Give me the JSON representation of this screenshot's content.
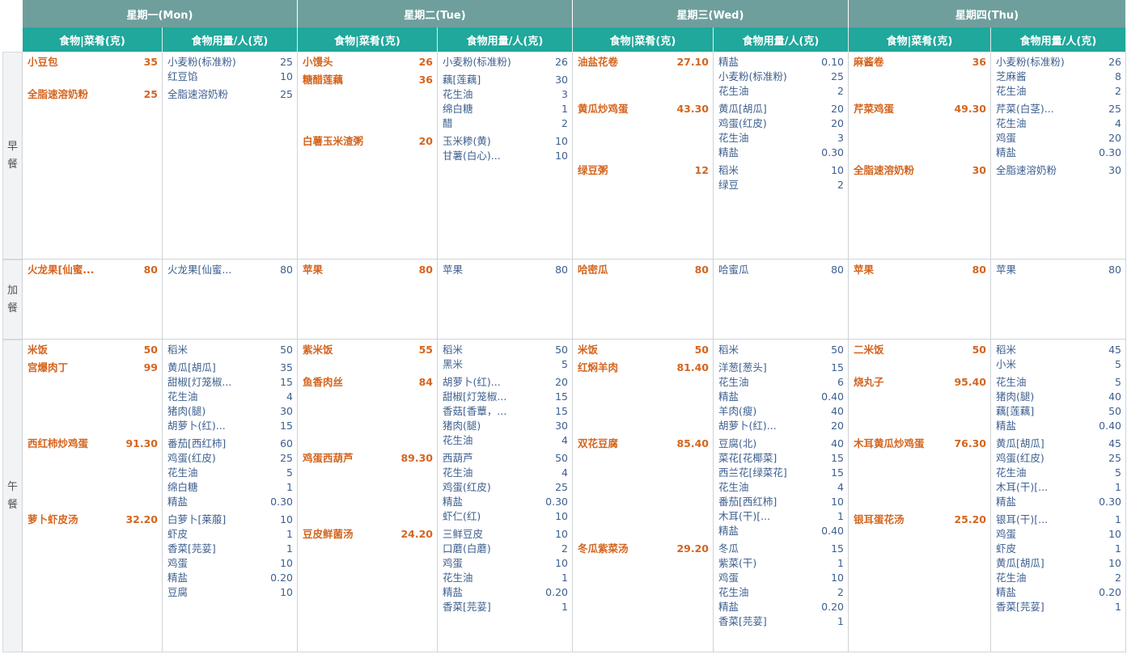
{
  "days": [
    {
      "label": "星期一(Mon)",
      "dish_header": "食物|菜肴(克)",
      "ing_header": "食物用量/人(克)"
    },
    {
      "label": "星期二(Tue)",
      "dish_header": "食物|菜肴(克)",
      "ing_header": "食物用量/人(克)"
    },
    {
      "label": "星期三(Wed)",
      "dish_header": "食物|菜肴(克)",
      "ing_header": "食物用量/人(克)"
    },
    {
      "label": "星期四(Thu)",
      "dish_header": "食物|菜肴(克)",
      "ing_header": "食物用量/人(克)"
    }
  ],
  "meals": [
    {
      "chars": [
        "早",
        "餐"
      ]
    },
    {
      "chars": [
        "加",
        "餐"
      ]
    },
    {
      "chars": [
        "午",
        "餐"
      ]
    }
  ],
  "menu": [
    [
      [
        {
          "name": "小豆包",
          "weight": "35",
          "ingredients": [
            [
              "小麦粉(标准粉)",
              "25"
            ],
            [
              "红豆馅",
              "10"
            ]
          ]
        },
        {
          "name": "全脂速溶奶粉",
          "weight": "25",
          "ingredients": [
            [
              "全脂速溶奶粉",
              "25"
            ]
          ]
        }
      ],
      [
        {
          "name": "火龙果[仙蜜...",
          "weight": "80",
          "ingredients": [
            [
              "火龙果[仙蜜...",
              "80"
            ]
          ]
        }
      ],
      [
        {
          "name": "米饭",
          "weight": "50",
          "ingredients": [
            [
              "稻米",
              "50"
            ]
          ]
        },
        {
          "name": "宫爆肉丁",
          "weight": "99",
          "ingredients": [
            [
              "黄瓜[胡瓜]",
              "35"
            ],
            [
              "甜椒[灯笼椒...",
              "15"
            ],
            [
              "花生油",
              "4"
            ],
            [
              "猪肉(腿)",
              "30"
            ],
            [
              "胡萝卜(红)...",
              "15"
            ]
          ]
        },
        {
          "name": "西红柿炒鸡蛋",
          "weight": "91.30",
          "ingredients": [
            [
              "番茄[西红柿]",
              "60"
            ],
            [
              "鸡蛋(红皮)",
              "25"
            ],
            [
              "花生油",
              "5"
            ],
            [
              "绵白糖",
              "1"
            ],
            [
              "精盐",
              "0.30"
            ]
          ]
        },
        {
          "name": "萝卜虾皮汤",
          "weight": "32.20",
          "ingredients": [
            [
              "白萝卜[莱菔]",
              "10"
            ],
            [
              "虾皮",
              "1"
            ],
            [
              "香菜[芫荽]",
              "1"
            ],
            [
              "鸡蛋",
              "10"
            ],
            [
              "精盐",
              "0.20"
            ],
            [
              "豆腐",
              "10"
            ]
          ]
        }
      ]
    ],
    [
      [
        {
          "name": "小馒头",
          "weight": "26",
          "ingredients": [
            [
              "小麦粉(标准粉)",
              "26"
            ]
          ]
        },
        {
          "name": "糖醋莲藕",
          "weight": "36",
          "ingredients": [
            [
              "藕[莲藕]",
              "30"
            ],
            [
              "花生油",
              "3"
            ],
            [
              "绵白糖",
              "1"
            ],
            [
              "醋",
              "2"
            ]
          ]
        },
        {
          "name": "白薯玉米渣粥",
          "weight": "20",
          "ingredients": [
            [
              "玉米糁(黄)",
              "10"
            ],
            [
              "甘薯(白心)...",
              "10"
            ]
          ]
        }
      ],
      [
        {
          "name": "苹果",
          "weight": "80",
          "ingredients": [
            [
              "苹果",
              "80"
            ]
          ]
        }
      ],
      [
        {
          "name": "紫米饭",
          "weight": "55",
          "ingredients": [
            [
              "稻米",
              "50"
            ],
            [
              "黑米",
              "5"
            ]
          ]
        },
        {
          "name": "鱼香肉丝",
          "weight": "84",
          "ingredients": [
            [
              "胡萝卜(红)...",
              "20"
            ],
            [
              "甜椒[灯笼椒...",
              "15"
            ],
            [
              "香菇[香蕈，...",
              "15"
            ],
            [
              "猪肉(腿)",
              "30"
            ],
            [
              "花生油",
              "4"
            ]
          ]
        },
        {
          "name": "鸡蛋西葫芦",
          "weight": "89.30",
          "ingredients": [
            [
              "西葫芦",
              "50"
            ],
            [
              "花生油",
              "4"
            ],
            [
              "鸡蛋(红皮)",
              "25"
            ],
            [
              "精盐",
              "0.30"
            ],
            [
              "虾仁(红)",
              "10"
            ]
          ]
        },
        {
          "name": "豆皮鲜菌汤",
          "weight": "24.20",
          "ingredients": [
            [
              "三鲜豆皮",
              "10"
            ],
            [
              "口蘑(白蘑)",
              "2"
            ],
            [
              "鸡蛋",
              "10"
            ],
            [
              "花生油",
              "1"
            ],
            [
              "精盐",
              "0.20"
            ],
            [
              "香菜[芫荽]",
              "1"
            ]
          ]
        }
      ]
    ],
    [
      [
        {
          "name": "油盐花卷",
          "weight": "27.10",
          "ingredients": [
            [
              "精盐",
              "0.10"
            ],
            [
              "小麦粉(标准粉)",
              "25"
            ],
            [
              "花生油",
              "2"
            ]
          ]
        },
        {
          "name": "黄瓜炒鸡蛋",
          "weight": "43.30",
          "ingredients": [
            [
              "黄瓜[胡瓜]",
              "20"
            ],
            [
              "鸡蛋(红皮)",
              "20"
            ],
            [
              "花生油",
              "3"
            ],
            [
              "精盐",
              "0.30"
            ]
          ]
        },
        {
          "name": "绿豆粥",
          "weight": "12",
          "ingredients": [
            [
              "稻米",
              "10"
            ],
            [
              "绿豆",
              "2"
            ]
          ]
        }
      ],
      [
        {
          "name": "哈密瓜",
          "weight": "80",
          "ingredients": [
            [
              "哈蜜瓜",
              "80"
            ]
          ]
        }
      ],
      [
        {
          "name": "米饭",
          "weight": "50",
          "ingredients": [
            [
              "稻米",
              "50"
            ]
          ]
        },
        {
          "name": "红焖羊肉",
          "weight": "81.40",
          "ingredients": [
            [
              "洋葱[葱头]",
              "15"
            ],
            [
              "花生油",
              "6"
            ],
            [
              "精盐",
              "0.40"
            ],
            [
              "羊肉(瘦)",
              "40"
            ],
            [
              "胡萝卜(红)...",
              "20"
            ]
          ]
        },
        {
          "name": "双花豆腐",
          "weight": "85.40",
          "ingredients": [
            [
              "豆腐(北)",
              "40"
            ],
            [
              "菜花[花椰菜]",
              "15"
            ],
            [
              "西兰花[绿菜花]",
              "15"
            ],
            [
              "花生油",
              "4"
            ],
            [
              "番茄[西红柿]",
              "10"
            ],
            [
              "木耳(干)[...",
              "1"
            ],
            [
              "精盐",
              "0.40"
            ]
          ]
        },
        {
          "name": "冬瓜紫菜汤",
          "weight": "29.20",
          "ingredients": [
            [
              "冬瓜",
              "15"
            ],
            [
              "紫菜(干)",
              "1"
            ],
            [
              "鸡蛋",
              "10"
            ],
            [
              "花生油",
              "2"
            ],
            [
              "精盐",
              "0.20"
            ],
            [
              "香菜[芫荽]",
              "1"
            ]
          ]
        }
      ]
    ],
    [
      [
        {
          "name": "麻酱卷",
          "weight": "36",
          "ingredients": [
            [
              "小麦粉(标准粉)",
              "26"
            ],
            [
              "芝麻酱",
              "8"
            ],
            [
              "花生油",
              "2"
            ]
          ]
        },
        {
          "name": "芹菜鸡蛋",
          "weight": "49.30",
          "ingredients": [
            [
              "芹菜(白茎)...",
              "25"
            ],
            [
              "花生油",
              "4"
            ],
            [
              "鸡蛋",
              "20"
            ],
            [
              "精盐",
              "0.30"
            ]
          ]
        },
        {
          "name": "全脂速溶奶粉",
          "weight": "30",
          "ingredients": [
            [
              "全脂速溶奶粉",
              "30"
            ]
          ]
        }
      ],
      [
        {
          "name": "苹果",
          "weight": "80",
          "ingredients": [
            [
              "苹果",
              "80"
            ]
          ]
        }
      ],
      [
        {
          "name": "二米饭",
          "weight": "50",
          "ingredients": [
            [
              "稻米",
              "45"
            ],
            [
              "小米",
              "5"
            ]
          ]
        },
        {
          "name": "烧丸子",
          "weight": "95.40",
          "ingredients": [
            [
              "花生油",
              "5"
            ],
            [
              "猪肉(腿)",
              "40"
            ],
            [
              "藕[莲藕]",
              "50"
            ],
            [
              "精盐",
              "0.40"
            ]
          ]
        },
        {
          "name": "木耳黄瓜炒鸡蛋",
          "weight": "76.30",
          "ingredients": [
            [
              "黄瓜[胡瓜]",
              "45"
            ],
            [
              "鸡蛋(红皮)",
              "25"
            ],
            [
              "花生油",
              "5"
            ],
            [
              "木耳(干)[...",
              "1"
            ],
            [
              "精盐",
              "0.30"
            ]
          ]
        },
        {
          "name": "银耳蛋花汤",
          "weight": "25.20",
          "ingredients": [
            [
              "银耳(干)[...",
              "1"
            ],
            [
              "鸡蛋",
              "10"
            ],
            [
              "虾皮",
              "1"
            ],
            [
              "黄瓜[胡瓜]",
              "10"
            ],
            [
              "花生油",
              "2"
            ],
            [
              "精盐",
              "0.20"
            ],
            [
              "香菜[芫荽]",
              "1"
            ]
          ]
        }
      ]
    ]
  ]
}
